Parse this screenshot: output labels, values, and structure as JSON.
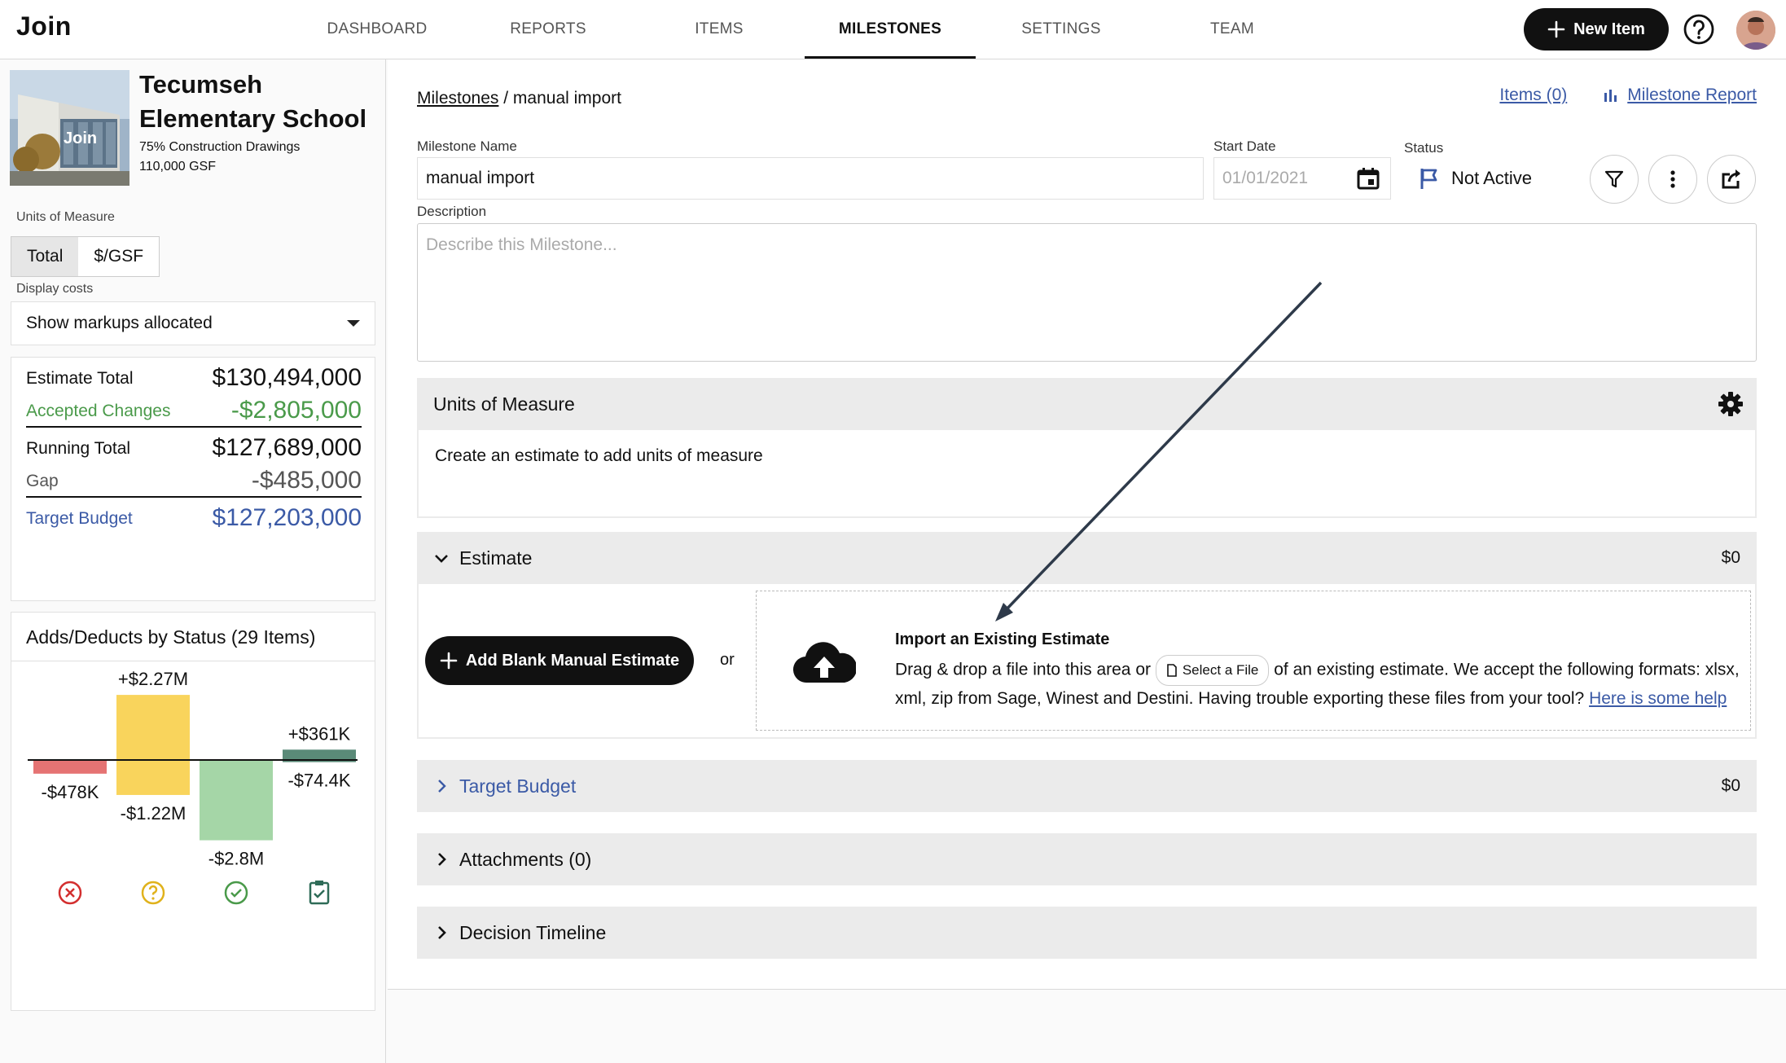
{
  "nav": {
    "logo": "Join",
    "tabs": [
      {
        "label": "DASHBOARD"
      },
      {
        "label": "REPORTS"
      },
      {
        "label": "ITEMS"
      },
      {
        "label": "MILESTONES"
      },
      {
        "label": "SETTINGS"
      },
      {
        "label": "TEAM"
      }
    ],
    "active_tab": "MILESTONES",
    "new_item_label": "New Item",
    "icons": {
      "help": "question-circle-icon",
      "avatar": "user-avatar"
    }
  },
  "project": {
    "title_line1": "Tecumseh",
    "title_line2": "Elementary School",
    "phase": "75% Construction Drawings",
    "gsf": "110,000 GSF",
    "image_label": "Join"
  },
  "sidebar": {
    "units_label": "Units of Measure",
    "units_options": [
      "Total",
      "$/GSF"
    ],
    "units_selected": "Total",
    "display_costs_label": "Display costs",
    "display_costs_value": "Show markups allocated",
    "totals": [
      {
        "label": "Estimate Total",
        "value": "$130,494,000",
        "color": "#111111"
      },
      {
        "label": "Accepted Changes",
        "value": "-$2,805,000",
        "color": "#4a9a4a"
      },
      {
        "label": "Running Total",
        "value": "$127,689,000",
        "color": "#111111"
      },
      {
        "label": "Gap",
        "value": "-$485,000",
        "color": "#555555"
      },
      {
        "label": "Target Budget",
        "value": "$127,203,000",
        "color": "#3b5aa6"
      }
    ]
  },
  "chart_data": {
    "type": "bar",
    "title": "Adds/Deducts by Status (29 Items)",
    "categories": [
      "Rejected",
      "Pending",
      "Accepted",
      "Incorporated"
    ],
    "category_icons": [
      "x-circle-icon",
      "question-circle-icon",
      "check-circle-icon",
      "clipboard-check-icon"
    ],
    "series": [
      {
        "name": "Adds",
        "values": [
          0,
          2.27,
          0,
          0.361
        ]
      },
      {
        "name": "Deducts",
        "values": [
          -0.478,
          -1.22,
          -2.8,
          -0.0744
        ]
      }
    ],
    "labels": {
      "adds": [
        "",
        "+$2.27M",
        "",
        "+$361K"
      ],
      "deducts": [
        "-$478K",
        "-$1.22M",
        "-$2.8M",
        "-$74.4K"
      ]
    },
    "colors": {
      "rejected": "#e57373",
      "pending": "#f9d45c",
      "accepted": "#a5d6a7",
      "incorporated": "#5a8a78"
    },
    "ylim": [
      -3.0,
      2.5
    ]
  },
  "main": {
    "breadcrumb_root": "Milestones",
    "breadcrumb_sep": "/",
    "breadcrumb_current": "manual import",
    "items_link": "Items (0)",
    "report_link": "Milestone Report",
    "milestone_name_label": "Milestone Name",
    "milestone_name_value": "manual import",
    "start_date_label": "Start Date",
    "start_date_placeholder": "01/01/2021",
    "status_label": "Status",
    "status_value": "Not Active",
    "description_label": "Description",
    "description_placeholder": "Describe this Milestone...",
    "uom_section_title": "Units of Measure",
    "uom_section_body": "Create an estimate to add units of measure",
    "estimate_title": "Estimate",
    "estimate_amount": "$0",
    "add_blank_label": "Add Blank Manual Estimate",
    "or_text": "or",
    "import_title": "Import an Existing Estimate",
    "import_text_1": "Drag & drop a file into this area or",
    "select_file_label": "Select a File",
    "import_text_2": "of an existing estimate. We accept the following formats: xlsx, xml, zip from Sage, Winest and Destini. Having trouble exporting these files from your tool?",
    "help_link": "Here is some help",
    "target_budget_title": "Target Budget",
    "target_budget_amount": "$0",
    "attachments_title": "Attachments (0)",
    "decision_timeline_title": "Decision Timeline"
  }
}
